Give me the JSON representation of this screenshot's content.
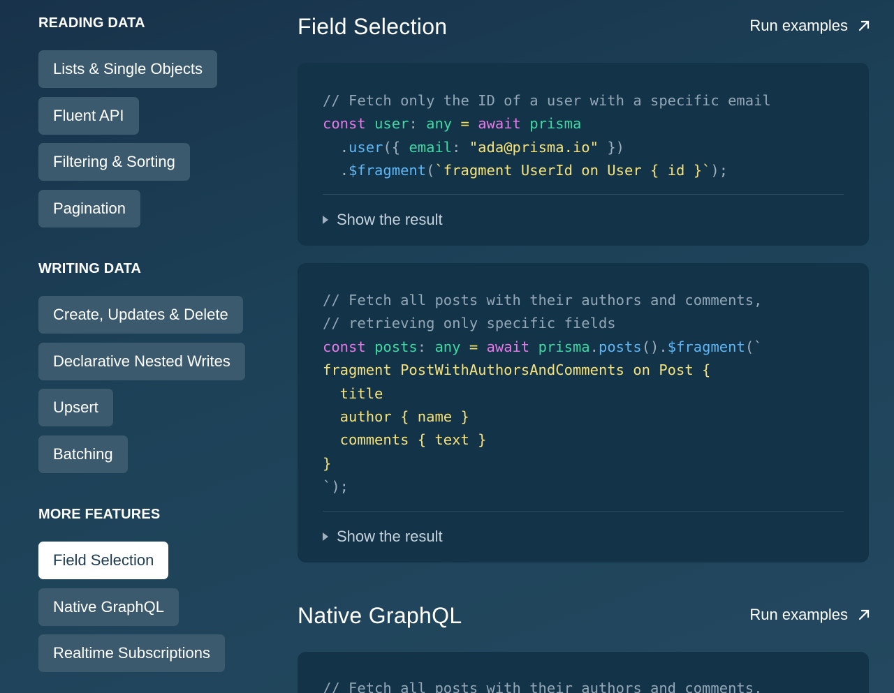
{
  "sidebar": {
    "sections": [
      {
        "heading": "READING DATA",
        "items": [
          "Lists & Single Objects",
          "Fluent API",
          "Filtering & Sorting",
          "Pagination"
        ]
      },
      {
        "heading": "WRITING DATA",
        "items": [
          "Create, Updates & Delete",
          "Declarative Nested Writes",
          "Upsert",
          "Batching"
        ]
      },
      {
        "heading": "MORE FEATURES",
        "items": [
          "Field Selection",
          "Native GraphQL",
          "Realtime Subscriptions"
        ],
        "active_item": "Field Selection"
      }
    ]
  },
  "main": {
    "sections": [
      {
        "title": "Field Selection",
        "run_label": "Run examples",
        "examples": [
          {
            "code": [
              "// Fetch only the ID of a user with a specific email",
              "const user: any = await prisma",
              "  .user({ email: \"ada@prisma.io\" })",
              "  .$fragment(`fragment UserId on User { id }`);"
            ],
            "toggle_label": "Show the result"
          },
          {
            "code": [
              "// Fetch all posts with their authors and comments,",
              "// retrieving only specific fields",
              "const posts: any = await prisma.posts().$fragment(`",
              "fragment PostWithAuthorsAndComments on Post {",
              "  title",
              "  author { name }",
              "  comments { text }",
              "}",
              "`);"
            ],
            "toggle_label": "Show the result"
          }
        ]
      },
      {
        "title": "Native GraphQL",
        "run_label": "Run examples",
        "examples": [
          {
            "code": [
              "// Fetch all posts with their authors and comments,"
            ]
          }
        ]
      }
    ]
  },
  "colors": {
    "background": "#1d4258",
    "nav_button": "#3c5a6e",
    "nav_button_active": "#ffffff",
    "code_card": "#133348",
    "keyword": "#e879e8",
    "identifier": "#3fd9a4",
    "function": "#5fb6f5",
    "string": "#f6e27a",
    "comment": "#93a7b6"
  },
  "icons": {
    "run_link": "external-arrow-icon",
    "toggle": "triangle-right-icon"
  }
}
